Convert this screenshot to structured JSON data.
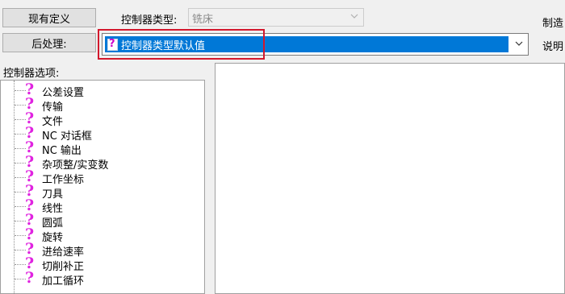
{
  "buttons": {
    "existing_definition": "现有定义",
    "post_processing": "后处理:"
  },
  "controller_type": {
    "label": "控制器类型:",
    "value": "铣床"
  },
  "post_combo": {
    "value": "控制器类型默认值"
  },
  "right_labels": {
    "manufacture": "制造",
    "description": "说明"
  },
  "options": {
    "label": "控制器选项:",
    "items": [
      "公差设置",
      "传输",
      "文件",
      "NC 对话框",
      "NC 输出",
      "杂项整/实变数",
      "工作坐标",
      "刀具",
      "线性",
      "圆弧",
      "旋转",
      "进给速率",
      "切削补正",
      "加工循环"
    ]
  },
  "icons": {
    "tree_item": "question-mark-icon",
    "dropdown": "chevron-down-icon"
  },
  "colors": {
    "selection": "#0078d7",
    "highlight_frame": "#d3182d",
    "question_icon": "#e024e0"
  }
}
